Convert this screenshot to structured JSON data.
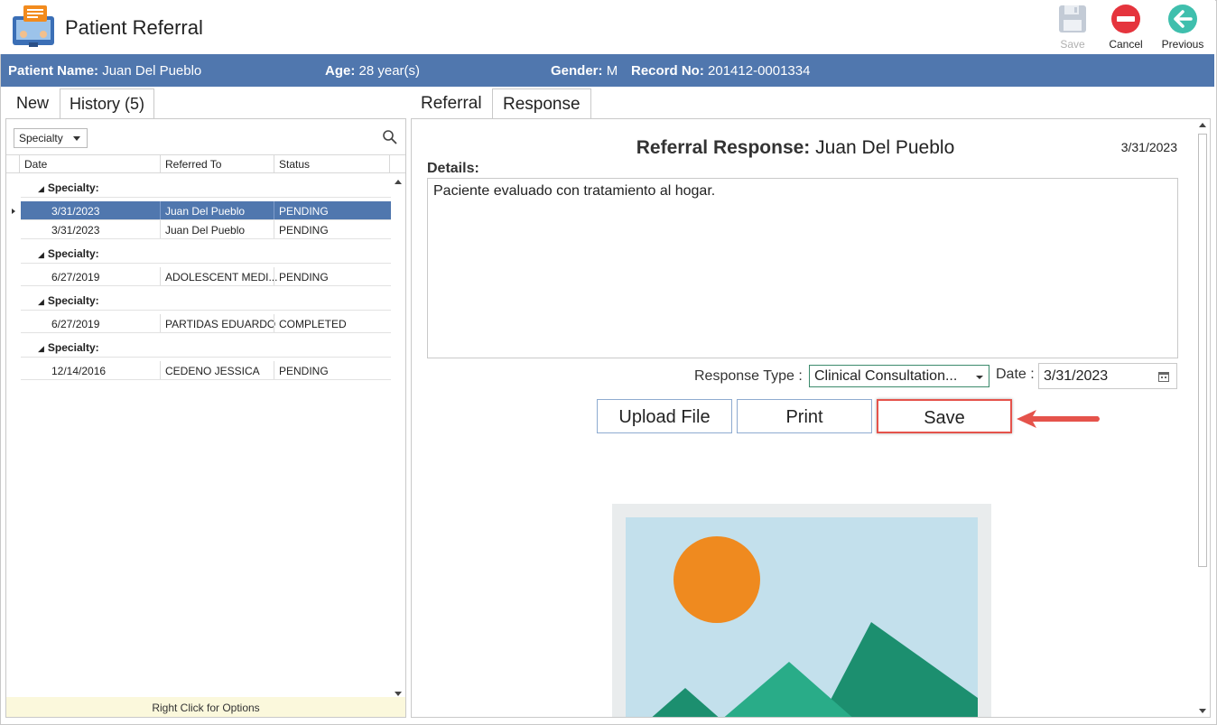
{
  "app": {
    "title": "Patient Referral",
    "toolbar": {
      "save_label": "Save",
      "cancel_label": "Cancel",
      "previous_label": "Previous"
    }
  },
  "patient": {
    "name_label": "Patient Name:",
    "name": "Juan Del Pueblo",
    "age_label": "Age:",
    "age": "28 year(s)",
    "gender_label": "Gender:",
    "gender": "M",
    "record_label": "Record No:",
    "record": "201412-0001334"
  },
  "left_tabs": {
    "new": "New",
    "history": "History",
    "history_count": "(5)"
  },
  "history": {
    "group_by": "Specialty",
    "columns": [
      "Date",
      "Referred To",
      "Status"
    ],
    "group_label": "Specialty:",
    "rows": [
      {
        "date": "3/31/2023",
        "referred_to": "Juan  Del Pueblo",
        "status": "PENDING"
      },
      {
        "date": "3/31/2023",
        "referred_to": "Juan  Del Pueblo",
        "status": "PENDING"
      },
      {
        "date": "6/27/2019",
        "referred_to": "ADOLESCENT MEDI...",
        "status": "PENDING"
      },
      {
        "date": "6/27/2019",
        "referred_to": "PARTIDAS EDUARDO",
        "status": "COMPLETED"
      },
      {
        "date": "12/14/2016",
        "referred_to": "CEDENO JESSICA",
        "status": "PENDING"
      }
    ],
    "footer_hint": "Right Click for Options"
  },
  "right_tabs": {
    "referral": "Referral",
    "response": "Response"
  },
  "response": {
    "title_label": "Referral Response:",
    "patient_name": "Juan  Del Pueblo",
    "date": "3/31/2023",
    "details_label": "Details:",
    "details_text": "Paciente evaluado con tratamiento al hogar.",
    "response_type_label": "Response Type :",
    "response_type_value": "Clinical Consultation...",
    "date_label": "Date :",
    "date_value": "3/31/2023",
    "buttons": {
      "upload": "Upload File",
      "print": "Print",
      "save": "Save"
    }
  },
  "colors": {
    "header_bar": "#5077ae",
    "selected_row": "#5077ae",
    "highlight": "#e5534b",
    "hint_bg": "#fbf8dc"
  }
}
